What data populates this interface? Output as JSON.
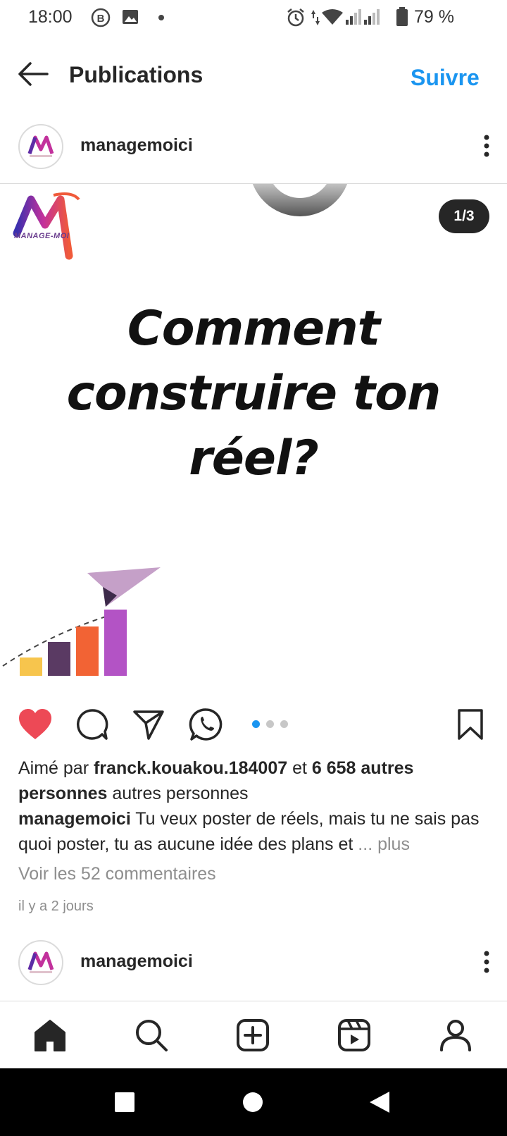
{
  "status_bar": {
    "time": "18:00",
    "battery_percent": "79 %",
    "icons": [
      "b-circle-icon",
      "gallery-icon",
      "dot-icon",
      "alarm-icon",
      "data-arrows-icon",
      "wifi-icon",
      "signal-icon",
      "signal-icon",
      "battery-icon"
    ]
  },
  "header": {
    "title": "Publications",
    "follow_label": "Suivre"
  },
  "post": {
    "username": "managemoici",
    "image": {
      "logo_text": "MANAGE-MOI",
      "headline_lines": [
        "Comment",
        "construire ton",
        "réel?"
      ],
      "carousel_counter": "1/3",
      "bar_colors": [
        "#f7c54d",
        "#5a3a63",
        "#f26334",
        "#b353c5"
      ],
      "plane_color": "#c5a0c8"
    },
    "actions": {
      "liked": true,
      "like_color": "#ed4956",
      "carousel_dots": 3,
      "active_dot": 0,
      "active_dot_color": "#1a95f0"
    },
    "likes": {
      "prefix": "Aimé par ",
      "user": "franck.kouakou.184007",
      "middle": " et ",
      "others": "6 658 autres personnes",
      "suffix": " autres personnes"
    },
    "caption": {
      "username": "managemoici",
      "text": " Tu veux poster de réels, mais tu ne sais pas quoi poster, tu as aucune idée des plans et ",
      "more": "... plus"
    },
    "comments_link": "Voir les 52 commentaires",
    "time_ago": "il y a 2 jours"
  },
  "next_post": {
    "username": "managemoici"
  },
  "bottom_nav": {
    "items": [
      "home-icon",
      "search-icon",
      "create-icon",
      "reels-icon",
      "profile-icon"
    ]
  }
}
